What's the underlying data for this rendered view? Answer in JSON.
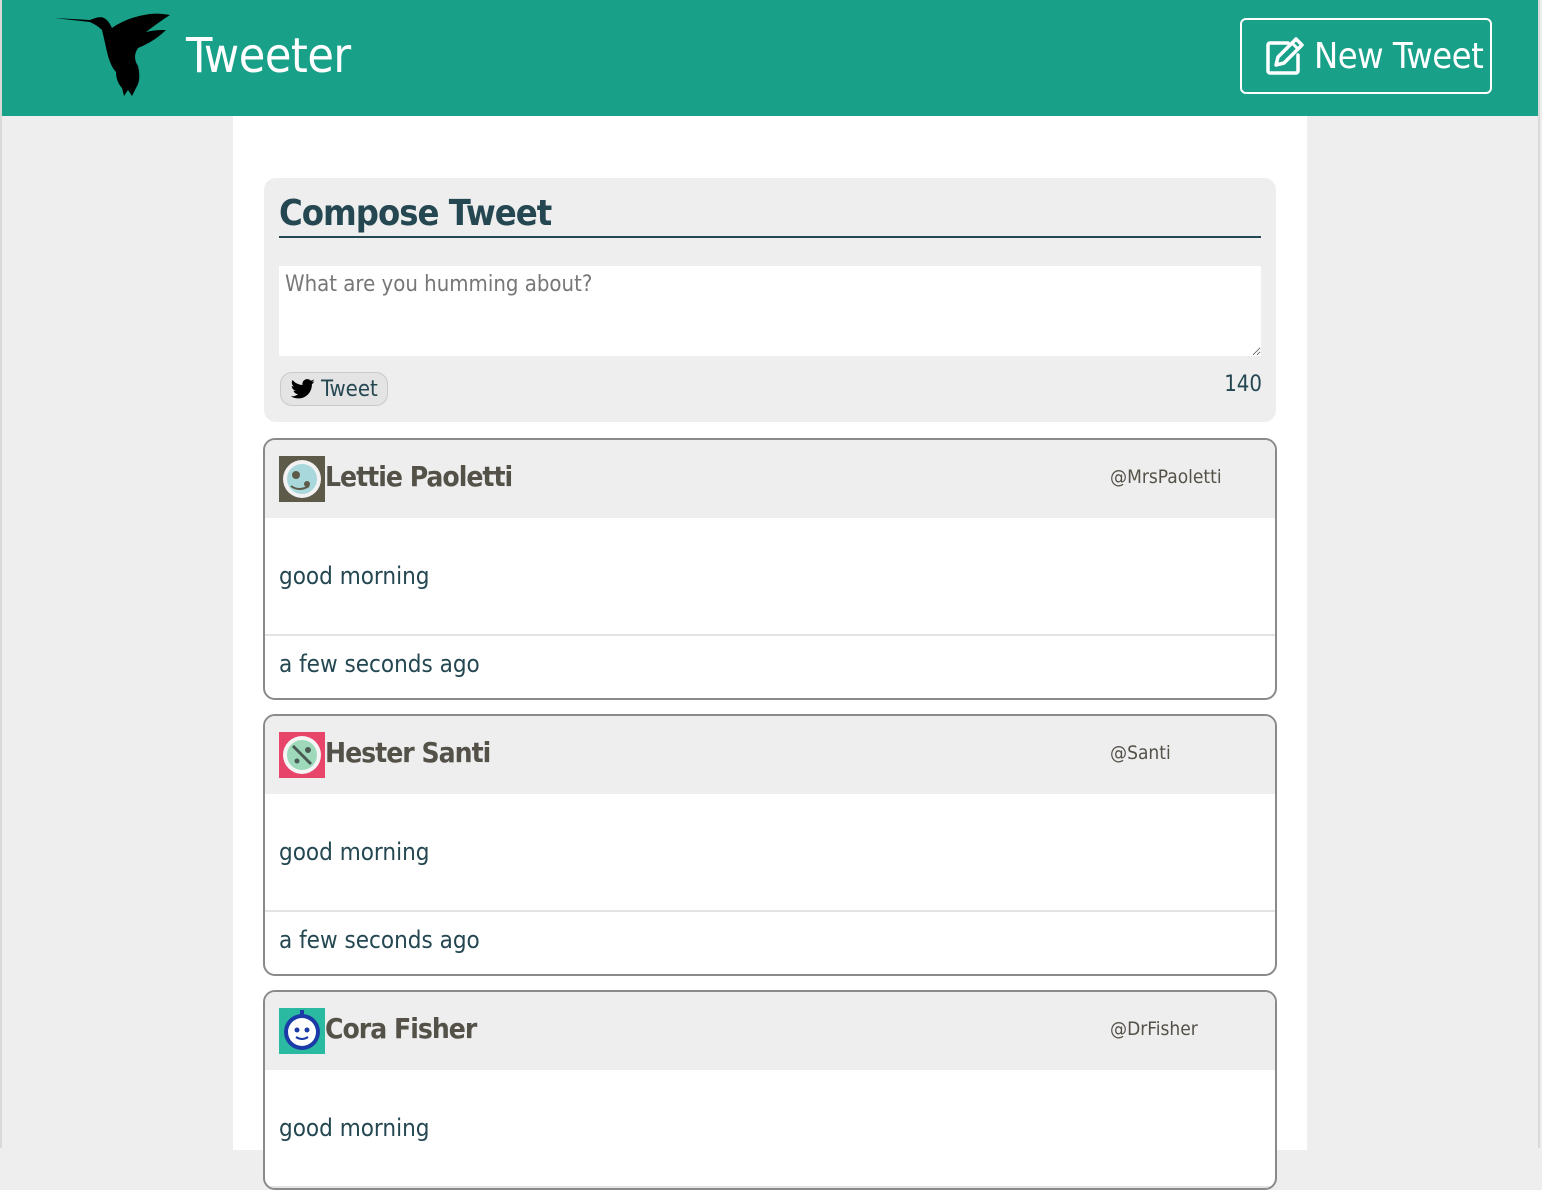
{
  "nav": {
    "brand": "Tweeter",
    "new_tweet_label": "New Tweet",
    "bg_color": "#18a088"
  },
  "compose": {
    "title": "Compose Tweet",
    "placeholder": "What are you humming about?",
    "submit_label": "Tweet",
    "counter": "140"
  },
  "tweets": [
    {
      "name": "Lettie Paoletti",
      "handle": "@MrsPaoletti",
      "text": "good morning",
      "time": "a few seconds ago",
      "avatar_bg": "#5d5a4a",
      "avatar_fg": "#a8d8dc"
    },
    {
      "name": "Hester Santi",
      "handle": "@Santi",
      "text": "good morning",
      "time": "a few seconds ago",
      "avatar_bg": "#e8456a",
      "avatar_fg": "#9fd9bb"
    },
    {
      "name": "Cora Fisher",
      "handle": "@DrFisher",
      "text": "good morning",
      "time": "",
      "avatar_bg": "#2ab9a1",
      "avatar_fg": "#1a3aa8"
    }
  ]
}
